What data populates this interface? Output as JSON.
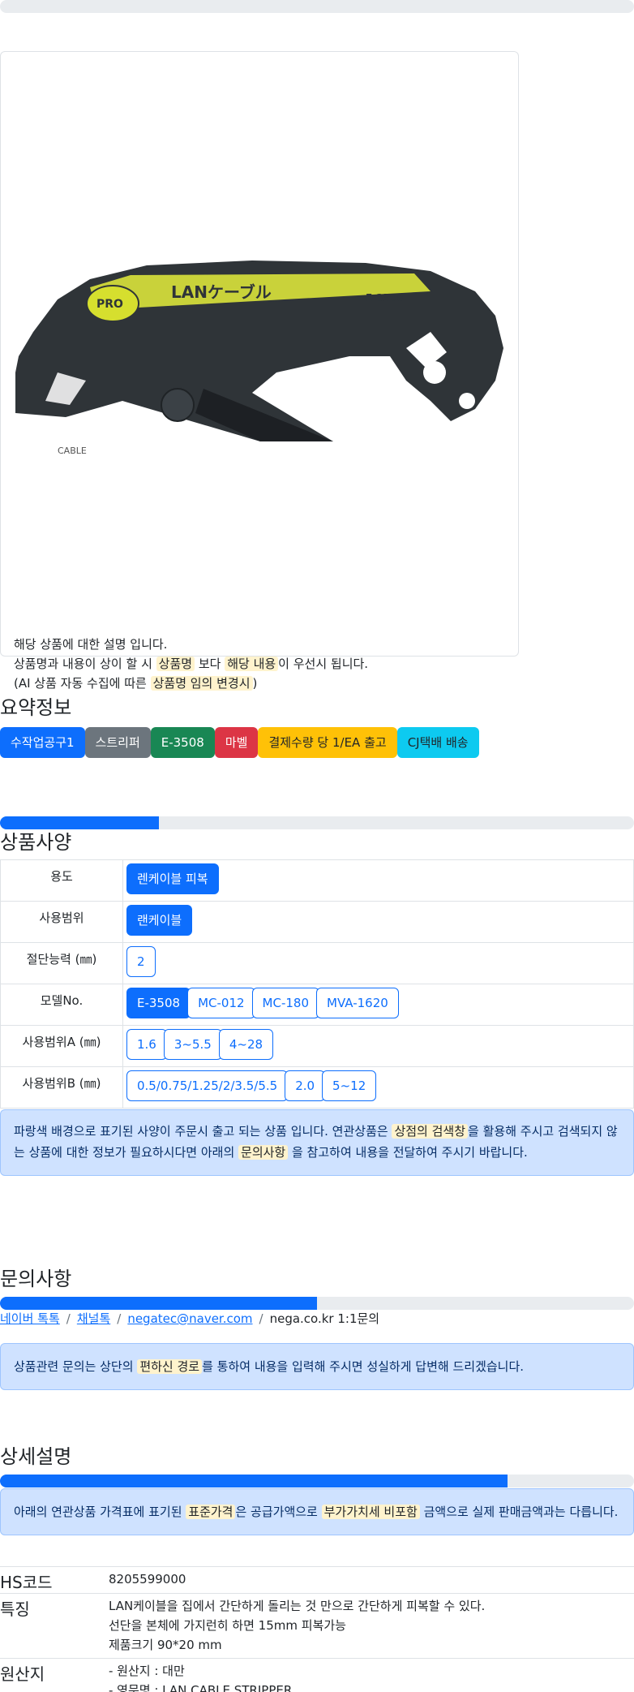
{
  "product_image": {
    "alt": "LAN 케이블 스트리퍼 E-3508",
    "brand_badge": "PRO",
    "label_text": "LANケーブル",
    "model_label": "E-3508",
    "body_text": "CABLE"
  },
  "notice": {
    "line1": "해당 상품에 대한 설명 입니다.",
    "line2_a": "상품명과 내용이 상이 할 시 ",
    "line2_mark1": "상품명",
    "line2_b": " 보다 ",
    "line2_mark2": "해당 내용",
    "line2_c": "이 우선시 됩니다.",
    "line3_a": "(AI 상품 자동 수집에 따른 ",
    "line3_mark": "상품명 임의 변경시",
    "line3_b": ")"
  },
  "summary": {
    "title": "요약정보",
    "badges": [
      {
        "label": "수작업공구1",
        "color": "#0d6efd",
        "text_color": "#ffffff"
      },
      {
        "label": "스트리퍼",
        "color": "#6c757d",
        "text_color": "#ffffff"
      },
      {
        "label": "E-3508",
        "color": "#198754",
        "text_color": "#ffffff"
      },
      {
        "label": "마벨",
        "color": "#dc3545",
        "text_color": "#ffffff"
      },
      {
        "label": "결제수량 당 1/EA 출고",
        "color": "#ffc107",
        "text_color": "#212529"
      },
      {
        "label": "CJ택배 배송",
        "color": "#0dcaf0",
        "text_color": "#212529"
      }
    ]
  },
  "progress": {
    "spec": 0.25,
    "inquiry": 0.5,
    "detail": 0.8
  },
  "spec": {
    "title": "상품사양",
    "rows": [
      {
        "key": "용도",
        "values": [
          {
            "label": "렌케이블 피복",
            "selected": true
          }
        ]
      },
      {
        "key": "사용범위",
        "values": [
          {
            "label": "랜케이블",
            "selected": true
          }
        ]
      },
      {
        "key": "절단능력 (㎜)",
        "values": [
          {
            "label": "2",
            "selected": false
          }
        ]
      },
      {
        "key": "모델No.",
        "values": [
          {
            "label": "E-3508",
            "selected": true
          },
          {
            "label": "MC-012",
            "selected": false
          },
          {
            "label": "MC-180",
            "selected": false
          },
          {
            "label": "MVA-1620",
            "selected": false
          }
        ]
      },
      {
        "key": "사용범위A (㎜)",
        "values": [
          {
            "label": "1.6",
            "selected": false
          },
          {
            "label": "3~5.5",
            "selected": false
          },
          {
            "label": "4~28",
            "selected": false
          }
        ]
      },
      {
        "key": "사용범위B (㎜)",
        "values": [
          {
            "label": "0.5/0.75/1.25/2/3.5/5.5",
            "selected": false
          },
          {
            "label": "2.0",
            "selected": false
          },
          {
            "label": "5~12",
            "selected": false
          }
        ]
      }
    ],
    "alert_a": "파랑색 배경으로 표기된 사양이 주문시 출고 되는 상품 입니다. 연관상품은 ",
    "alert_mark1": "상점의 검색창",
    "alert_b": "을 활용해 주시고 검색되지 않는 상품에 대한 정보가 필요하시다면 아래의 ",
    "alert_mark2": "문의사항",
    "alert_c": " 을 참고하여 내용을 전달하여 주시기 바랍니다."
  },
  "inquiry": {
    "title": "문의사항",
    "links": [
      "네이버 톡톡",
      "채널톡",
      "negatec@naver.com"
    ],
    "current": "nega.co.kr 1:1문의",
    "separator": "/",
    "alert_a": "상품관련 문의는 상단의 ",
    "alert_mark": "편하신 경로",
    "alert_b": "를 통하여 내용을 입력해 주시면 성실하게 답변해 드리겠습니다."
  },
  "detail": {
    "title": "상세설명",
    "alert_a": "아래의 연관상품 가격표에 표기된 ",
    "alert_mark1": "표준가격",
    "alert_b": "은 공급가액으로 ",
    "alert_mark2": "부가가치세 비포함",
    "alert_c": " 금액으로 실제 판매금액과는 다릅니다.",
    "table": {
      "hs_key": "HS코드",
      "hs_value": "8205599000",
      "feature_key": "특징",
      "feature_lines": [
        "LAN케이블을 집에서 간단하게 돌리는 것 만으로 간단하게 피복할 수 있다.",
        "선단을 본체에 가지런히 하면 15mm 피복가능",
        "제품크기 90*20 mm"
      ],
      "origin_key": "원산지",
      "origin_lines": [
        "- 원산지 : 대만",
        "- 영문명 : LAN CABLE STRIPPER"
      ]
    }
  }
}
